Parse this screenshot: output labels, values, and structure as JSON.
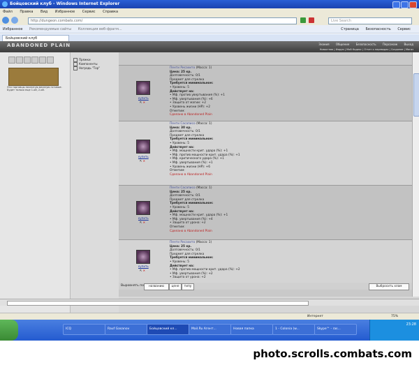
{
  "window": {
    "title": "Бойцовский клуб - Windows Internet Explorer"
  },
  "menubar": [
    "Файл",
    "Правка",
    "Вид",
    "Избранное",
    "Сервис",
    "Справка"
  ],
  "addressbar": {
    "url": "http://dungeon.combats.com/",
    "search_placeholder": "Live Search"
  },
  "favbar": {
    "favorites": "Избранное",
    "links": [
      "Рекомендуемые сайты",
      "Коллекция веб-фрагм..."
    ],
    "right": [
      "Страница",
      "Безопасность",
      "Сервис"
    ]
  },
  "tab": {
    "title": "Бойцовский клуб"
  },
  "game": {
    "logo": "ABANDONED PLAIN",
    "nav": [
      "Знания",
      "Общение",
      "Безопасность",
      "Персонаж",
      "Выход"
    ],
    "subnav": "Новостная | Форум | Мой Кодекс | Отчет о переводах | Создание | Магаз",
    "left_note": "Эти торговцы начнитую веселую готовые. Будет только еще 1-ой, 2-ой."
  },
  "filters": [
    "Пряжки",
    "Компоненты",
    "Наградь \"Тор\""
  ],
  "items": [
    {
      "name": "Пенти Рисахито",
      "mass": "(Масса: 1)",
      "price": "Цена: 25 кр.",
      "durability": "Долговечность: 0/1",
      "subtype": "Предмет для стрелка",
      "req_title": "Требуется минимальное:",
      "req": "• Уровень: 5",
      "acts_title": "Действует на:",
      "acts": [
        "• Мф. против увертывания (%): +1",
        "• Мф. увертывания (%): +6",
        "• Защита от магии: +2",
        "• Уровень жизни (HP): +2"
      ],
      "note": "Отметим:",
      "note2": "Сделано в Abandoned Plain",
      "buy": "купить"
    },
    {
      "name": "Пенти Сасаписо",
      "mass": "(Масса: 1)",
      "price": "Цена: 30 кр.",
      "durability": "Долговечность: 0/1",
      "subtype": "Предмет для стрелка",
      "req_title": "Требуется минимальное:",
      "req": "• Уровень: 5",
      "acts_title": "Действует на:",
      "acts": [
        "• Мф. мощности крит. удара (%): +1",
        "• Мф. против мощности крит. удара (%): +1",
        "• Мф. критического удара (%): +1",
        "• Мф. увертывания (%): +1",
        "• Уровень жизни (HP): +6"
      ],
      "note": "Отметим:",
      "note2": "Сделано в Abandoned Plain",
      "buy": "купить"
    },
    {
      "name": "Пенти Сасаписо",
      "mass": "(Масса: 1)",
      "price": "Цена: 25 кр.",
      "durability": "Долговечность: 0/1",
      "subtype": "Предмет для стрелка",
      "req_title": "Требуется минимальное:",
      "req": "• Уровень: 5",
      "acts_title": "Действует на:",
      "acts": [
        "• Мф. мощности крит. удара (%): +1",
        "• Мф. увертывания (%): +4",
        "• Защита от урона: +2"
      ],
      "note": "Отметим:",
      "note2": "Сделано в Abandoned Plain",
      "buy": "купить"
    },
    {
      "name": "Пенти Рисахито",
      "mass": "(Масса: 1)",
      "price": "Цена: 25 кр.",
      "durability": "Долговечность: 0/1",
      "subtype": "Предмет для стрелка",
      "req_title": "Требуется минимальное:",
      "req": "• Уровень: 5",
      "acts_title": "Действует на:",
      "acts": [
        "• Мф. против мощности крит. удара (%): +2",
        "• Мф. увертывания (%): +2",
        "• Защита от урона: +2"
      ],
      "note": "Отметим:",
      "note2": "Сделано в Abandoned Plain",
      "buy": "купить"
    }
  ],
  "sortbar": {
    "label": "Выровнять по",
    "buttons": [
      "названию",
      "цене",
      "типу"
    ],
    "clear": "Выбросить хлам"
  },
  "statusbar": {
    "zone": "Интернет",
    "zoom": "75%"
  },
  "taskbar": {
    "buttons": [
      "ICQ",
      "Rauf Gasanov",
      "Бойцовский кл...",
      "Mail.Ru Агент...",
      "Новая папка",
      "1 - Colonia (w...",
      "Skype™ - ras..."
    ],
    "clock": "23:28"
  },
  "watermark": "photo.scrolls.combats.com"
}
